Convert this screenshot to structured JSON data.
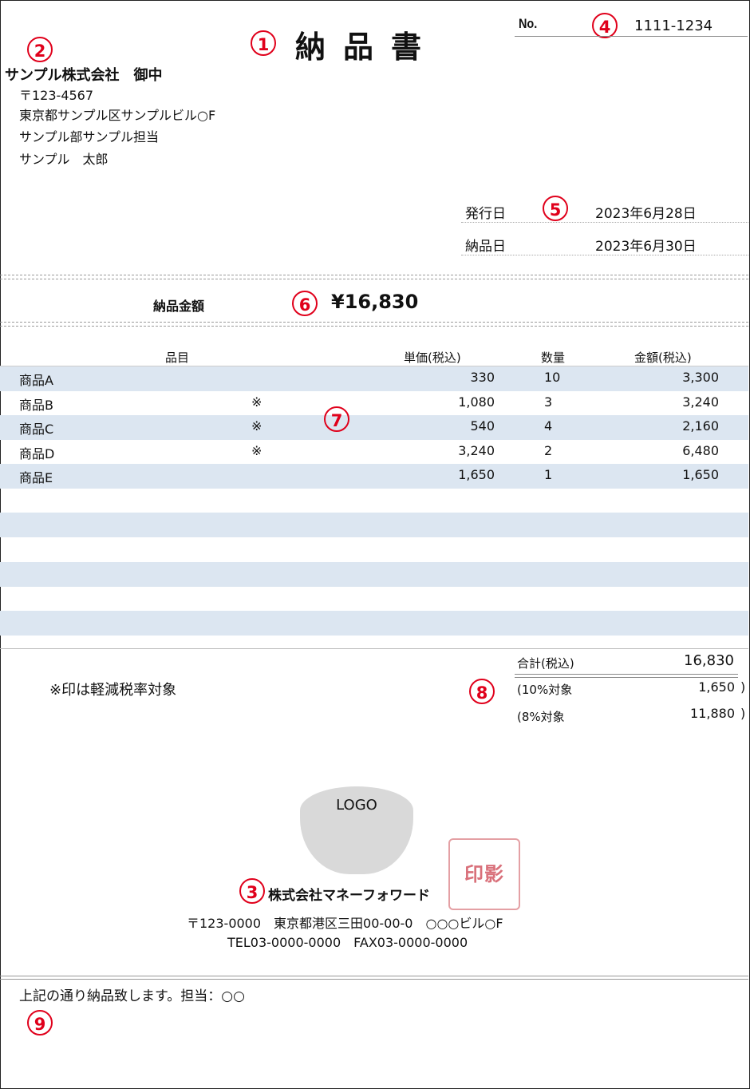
{
  "document": {
    "title": "納品書",
    "no_label": "No.",
    "no_value": "1111-1234"
  },
  "recipient": {
    "company": "サンプル株式会社　御中",
    "postal": "〒123-4567",
    "address": "東京都サンプル区サンプルビル○F",
    "department": "サンプル部サンプル担当",
    "person": "サンプル　太郎"
  },
  "dates": {
    "issue_label": "発行日",
    "issue_value": "2023年6月28日",
    "delivery_label": "納品日",
    "delivery_value": "2023年6月30日"
  },
  "amount": {
    "label": "納品金額",
    "value": "¥16,830"
  },
  "table": {
    "headers": {
      "item": "品目",
      "price": "単価(税込)",
      "qty": "数量",
      "amount": "金額(税込)"
    },
    "rows": [
      {
        "name": "商品A",
        "mark": "",
        "price": "330",
        "qty": "10",
        "amount": "3,300"
      },
      {
        "name": "商品B",
        "mark": "※",
        "price": "1,080",
        "qty": "3",
        "amount": "3,240"
      },
      {
        "name": "商品C",
        "mark": "※",
        "price": "540",
        "qty": "4",
        "amount": "2,160"
      },
      {
        "name": "商品D",
        "mark": "※",
        "price": "3,240",
        "qty": "2",
        "amount": "6,480"
      },
      {
        "name": "商品E",
        "mark": "",
        "price": "1,650",
        "qty": "1",
        "amount": "1,650"
      }
    ]
  },
  "note": "※印は軽減税率対象",
  "totals": {
    "sum_label": "合計(税込)",
    "sum_value": "16,830",
    "tax10_label": "(10%対象",
    "tax10_value": "1,650",
    "tax8_label": "(8%対象",
    "tax8_value": "11,880",
    "paren": ")"
  },
  "issuer": {
    "logo": "LOGO",
    "seal": "印影",
    "company": "株式会社マネーフォワード",
    "address": "〒123-0000　東京都港区三田00-00-0　○○○ビル○F",
    "contact": "TEL03-0000-0000　FAX03-0000-0000"
  },
  "remarks": "上記の通り納品致します。担当：○○",
  "markers": [
    "1",
    "2",
    "3",
    "4",
    "5",
    "6",
    "7",
    "8",
    "9"
  ],
  "colors": {
    "marker": "#e0001b",
    "row_shade": "#dce6f1",
    "seal": "#d9707a"
  }
}
